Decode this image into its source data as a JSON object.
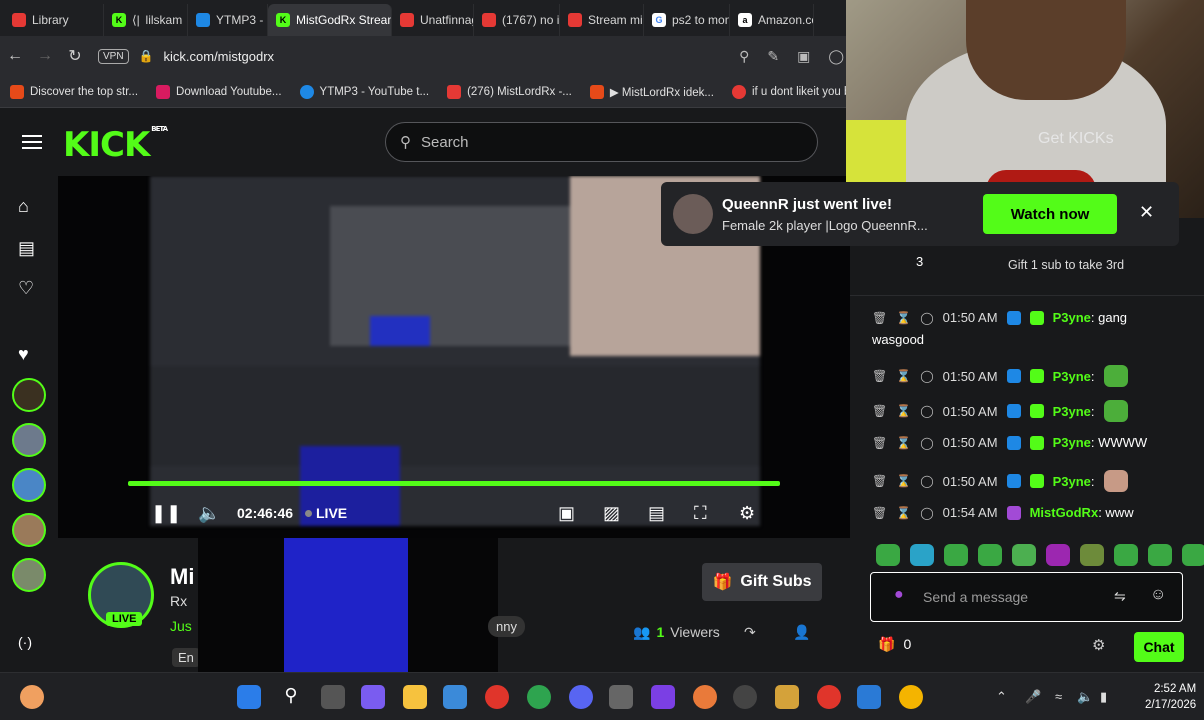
{
  "browser": {
    "tabs": [
      {
        "label": "Library",
        "color": "#e53935",
        "active": false
      },
      {
        "label": "⟨|  lilskam",
        "color": "#53fc18",
        "active": false
      },
      {
        "label": "YTMP3 - Fr",
        "color": "#1e88e5",
        "active": false
      },
      {
        "label": "MistGodRx Stream",
        "color": "#53fc18",
        "active": true
      },
      {
        "label": "Unatfinnag",
        "color": "#e53935",
        "active": false
      },
      {
        "label": "(1767) no i",
        "color": "#e53935",
        "active": false
      },
      {
        "label": "Stream mis",
        "color": "#e53935",
        "active": false
      },
      {
        "label": "ps2 to mon",
        "color": "#ffffff",
        "active": false
      },
      {
        "label": "Amazon.co",
        "color": "#ffffff",
        "active": false
      }
    ],
    "vpn_label": "VPN",
    "url": "kick.com/mistgodrx",
    "bookmarks": [
      {
        "label": "Discover the top str...",
        "color": "#e64a19"
      },
      {
        "label": "Download Youtube...",
        "color": "#d81b60"
      },
      {
        "label": "YTMP3 - YouTube t...",
        "color": "#1e88e5"
      },
      {
        "label": "(276) MistLordRx -...",
        "color": "#e53935"
      },
      {
        "label": "▶ MistLordRx idek...",
        "color": "#e64a19"
      },
      {
        "label": "if u dont likeit you b...",
        "color": "#e53935"
      }
    ]
  },
  "kick": {
    "logo": "KICK",
    "logo_beta": "BETA",
    "search_placeholder": "Search"
  },
  "player": {
    "timecode": "02:46:46",
    "live_label": "LIVE",
    "progress": 1.0
  },
  "stream": {
    "name": "Mi",
    "title": "Rx",
    "category": "Jus",
    "language": "En",
    "tag": "nny",
    "live_badge": "LIVE",
    "gift_label": "Gift Subs",
    "viewers_count": "1",
    "viewers_label": "Viewers"
  },
  "notification": {
    "title": "QueennR just went live!",
    "subtitle": "Female 2k player |Logo QueennR...",
    "watch_label": "Watch now"
  },
  "chat": {
    "leader_rank": "3",
    "leader_gift": "Gift 1 sub to take 3rd",
    "messages": [
      {
        "time": "01:50 AM",
        "user": "P3yne",
        "text": "gang",
        "text2": "wasgood",
        "color": "#53fc18"
      },
      {
        "time": "01:50 AM",
        "user": "P3yne",
        "text": "",
        "text2": "",
        "color": "#53fc18"
      },
      {
        "time": "01:50 AM",
        "user": "P3yne",
        "text": "",
        "text2": "",
        "color": "#53fc18"
      },
      {
        "time": "01:50 AM",
        "user": "P3yne",
        "text": "WWWW",
        "text2": "",
        "color": "#53fc18"
      },
      {
        "time": "01:50 AM",
        "user": "P3yne",
        "text": "",
        "text2": "",
        "color": "#53fc18"
      },
      {
        "time": "01:54 AM",
        "user": "MistGodRx",
        "text": "www",
        "text2": "",
        "color": "#53fc18"
      }
    ],
    "input_placeholder": "Send a message",
    "kicks_count": "0",
    "chat_button": "Chat"
  },
  "webcam": {
    "overlay_text": "Get KICKs"
  },
  "taskbar": {
    "time": "2:52 AM",
    "date": "2/17/2026"
  },
  "colors": {
    "kick_green": "#53fc18",
    "background": "#18191b"
  }
}
